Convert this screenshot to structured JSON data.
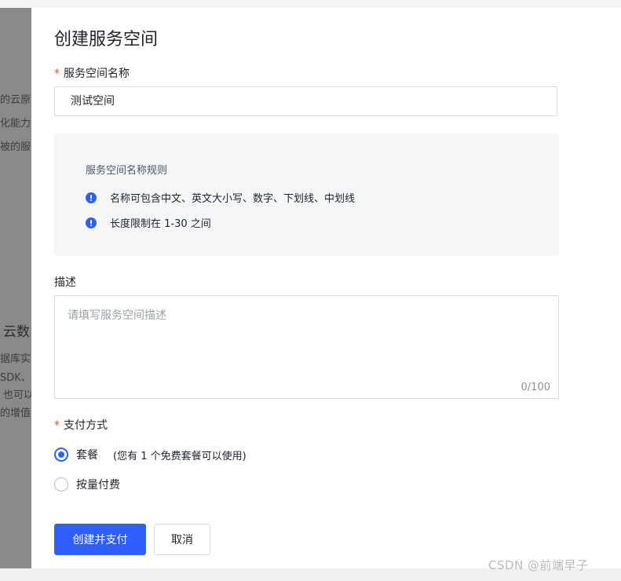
{
  "background": {
    "fragments": [
      "的云原",
      "化能力",
      "被的服务",
      "云数",
      "据库实",
      "SDK、",
      "也可以",
      "的增值"
    ]
  },
  "dialog": {
    "title": "创建服务空间",
    "name_field": {
      "required_mark": "*",
      "label": "服务空间名称",
      "value": "测试空间"
    },
    "rules": {
      "title": "服务空间名称规则",
      "items": [
        "名称可包含中文、英文大小写、数字、下划线、中划线",
        "长度限制在 1-30 之间"
      ]
    },
    "description_field": {
      "label": "描述",
      "placeholder": "请填写服务空间描述",
      "counter": "0/100"
    },
    "payment": {
      "required_mark": "*",
      "label": "支付方式",
      "options": [
        {
          "label": "套餐",
          "note": "(您有 1 个免费套餐可以使用)",
          "selected": true
        },
        {
          "label": "按量付费",
          "selected": false
        }
      ]
    },
    "buttons": {
      "confirm": "创建并支付",
      "cancel": "取消"
    }
  },
  "watermark": "CSDN @前端早子",
  "colors": {
    "accent": "#2f5fff",
    "required": "#e5484d",
    "overlay": "#8a8a8a"
  }
}
